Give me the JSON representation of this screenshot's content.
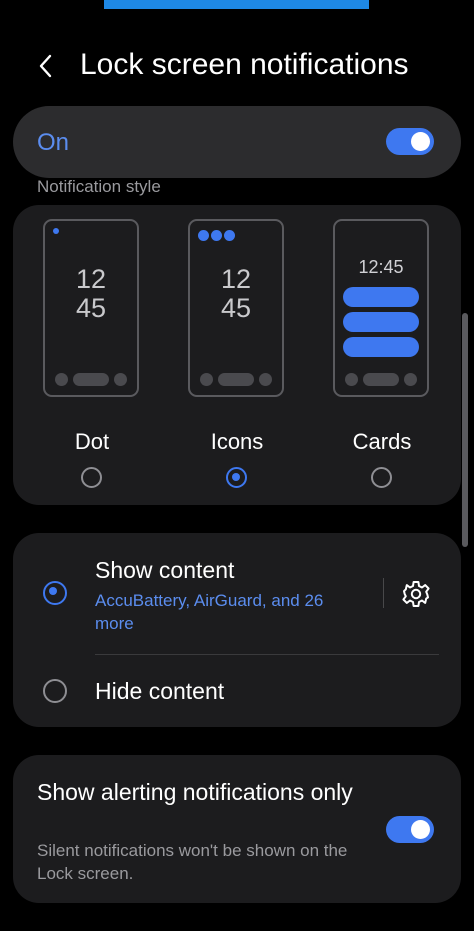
{
  "header": {
    "title": "Lock screen notifications"
  },
  "master_toggle": {
    "label": "On",
    "state": true
  },
  "notification_style": {
    "section_label": "Notification style",
    "selected": "Icons",
    "options": [
      {
        "label": "Dot"
      },
      {
        "label": "Icons"
      },
      {
        "label": "Cards",
        "preview_time": "12:45"
      }
    ],
    "preview_clock": {
      "hours": "12",
      "minutes": "45"
    }
  },
  "content_visibility": {
    "selected": "Show content",
    "show": {
      "label": "Show content",
      "apps_summary": "AccuBattery, AirGuard, and 26 more"
    },
    "hide": {
      "label": "Hide content"
    }
  },
  "alerting": {
    "title": "Show alerting notifications only",
    "description": "Silent notifications won't be shown on the Lock screen.",
    "state": true
  },
  "colors": {
    "accent": "#3e78f0",
    "accent_text": "#5b8def",
    "background": "#000000",
    "card": "#1c1c1e",
    "master_card": "#2c2c2e",
    "top_bar": "#1e88e5"
  },
  "icons": [
    "back-arrow-icon",
    "gear-icon"
  ]
}
